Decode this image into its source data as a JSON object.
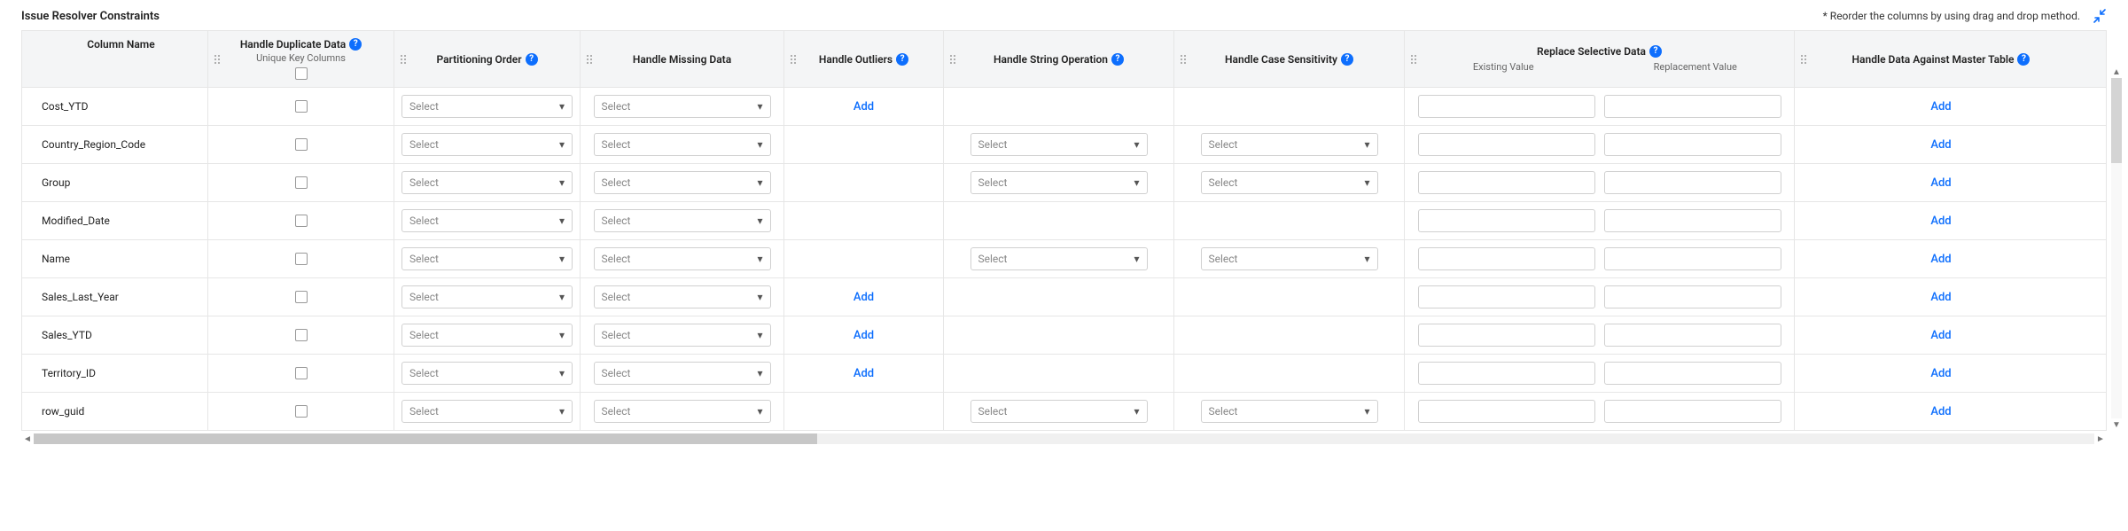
{
  "header": {
    "title": "Issue Resolver Constraints",
    "hint": "* Reorder the columns by using drag and drop method."
  },
  "columns": {
    "colname": {
      "label": "Column Name"
    },
    "duplicate": {
      "label": "Handle Duplicate Data",
      "sub": "Unique Key Columns"
    },
    "partition": {
      "label": "Partitioning Order"
    },
    "missing": {
      "label": "Handle Missing Data"
    },
    "outliers": {
      "label": "Handle Outliers"
    },
    "stringop": {
      "label": "Handle String Operation"
    },
    "casesens": {
      "label": "Handle Case Sensitivity"
    },
    "replace": {
      "label": "Replace Selective Data",
      "sub_left": "Existing Value",
      "sub_right": "Replacement Value"
    },
    "master": {
      "label": "Handle Data Against Master Table"
    }
  },
  "labels": {
    "select_placeholder": "Select",
    "add": "Add"
  },
  "rows": [
    {
      "name": "Cost_YTD",
      "show_outliers_add": true,
      "show_string_select": false,
      "show_case_select": false,
      "show_replace_inputs": true,
      "show_master_add": true
    },
    {
      "name": "Country_Region_Code",
      "show_outliers_add": false,
      "show_string_select": true,
      "show_case_select": true,
      "show_replace_inputs": true,
      "show_master_add": true
    },
    {
      "name": "Group",
      "show_outliers_add": false,
      "show_string_select": true,
      "show_case_select": true,
      "show_replace_inputs": true,
      "show_master_add": true
    },
    {
      "name": "Modified_Date",
      "show_outliers_add": false,
      "show_string_select": false,
      "show_case_select": false,
      "show_replace_inputs": true,
      "show_master_add": true
    },
    {
      "name": "Name",
      "show_outliers_add": false,
      "show_string_select": true,
      "show_case_select": true,
      "show_replace_inputs": true,
      "show_master_add": true
    },
    {
      "name": "Sales_Last_Year",
      "show_outliers_add": true,
      "show_string_select": false,
      "show_case_select": false,
      "show_replace_inputs": true,
      "show_master_add": true
    },
    {
      "name": "Sales_YTD",
      "show_outliers_add": true,
      "show_string_select": false,
      "show_case_select": false,
      "show_replace_inputs": true,
      "show_master_add": true
    },
    {
      "name": "Territory_ID",
      "show_outliers_add": true,
      "show_string_select": false,
      "show_case_select": false,
      "show_replace_inputs": true,
      "show_master_add": true
    },
    {
      "name": "row_guid",
      "show_outliers_add": false,
      "show_string_select": true,
      "show_case_select": true,
      "show_replace_inputs": true,
      "show_master_add": true
    }
  ]
}
